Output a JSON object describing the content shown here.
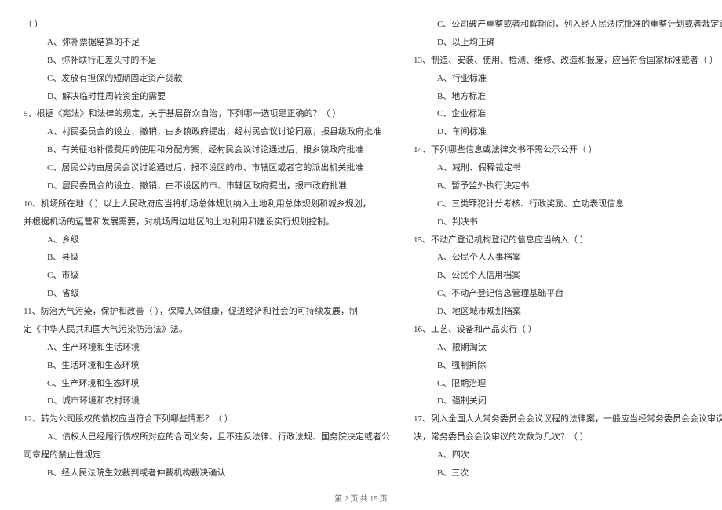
{
  "left": {
    "frag_top": "（    ）",
    "q8_A": "A、弥补票据结算的不足",
    "q8_B": "B、弥补联行汇差头寸的不足",
    "q8_C": "C、发放有担保的短期固定资产贷款",
    "q8_D": "D、解决临时性周转资金的需要",
    "q9_stem": "9、根据《宪法》和法律的规定，关于基层群众自治，下列哪一选项是正确的？（    ）",
    "q9_A": "A、村民委员会的设立、撤销，由乡镇政府提出，经村民会议讨论同意，报县级政府批准",
    "q9_B": "B、有关征地补偿费用的使用和分配方案，经村民会议讨论通过后，报乡镇政府批准",
    "q9_C": "C、居民公约由居民会议讨论通过后，报不设区的市、市辖区或者它的派出机关批准",
    "q9_D": "D、居民委员会的设立、撤销，由不设区的市、市辖区政府提出，报市政府批准",
    "q10_stem_l1": "10、机场所在地（    ）以上人民政府应当将机场总体规划纳入土地利用总体规划和城乡规划，",
    "q10_stem_l2": "并根据机场的运营和发展需要，对机场周边地区的土地利用和建设实行规划控制。",
    "q10_A": "A、乡级",
    "q10_B": "B、县级",
    "q10_C": "C、市级",
    "q10_D": "D、省级",
    "q11_stem_l1": "11、防治大气污染，保护和改善（    ），保障人体健康，促进经济和社会的可持续发展，制",
    "q11_stem_l2": "定《中华人民共和国大气污染防治法》法。",
    "q11_A": "A、生产环境和生活环境",
    "q11_B": "B、生活环境和生态环境",
    "q11_C": "C、生产环境和生态环境",
    "q11_D": "D、城市环境和农村环境",
    "q12_stem": "12、转为公司股权的债权应当符合下列哪些情形？（    ）",
    "q12_A_l1": "A、债权人已经履行债权所对应的合同义务，且不违反法律、行政法规、国务院决定或者公",
    "q12_A_l2": "司章程的禁止性规定",
    "q12_B": "B、经人民法院生效裁判或者仲裁机构裁决确认"
  },
  "right": {
    "q12_C": "C、公司破产重整或者和解期间，列入经人民法院批准的重整计划或者裁定认可的和解协议。",
    "q12_D": "D、以上均正确",
    "q13_stem": "13、制造、安装、使用、检测、维修、改造和报废，应当符合国家标准或者（    ）",
    "q13_A": "A、行业标准",
    "q13_B": "B、地方标准",
    "q13_C": "C、企业标准",
    "q13_D": "D、车间标准",
    "q14_stem": "14、下列哪些信息或法律文书不需公示公开（    ）",
    "q14_A": "A、减刑、假释裁定书",
    "q14_B": "B、暂予监外执行决定书",
    "q14_C": "C、三类罪犯计分考核、行政奖励、立功表现信息",
    "q14_D": "D、判决书",
    "q15_stem": "15、不动产登记机构登记的信息应当纳入（    ）",
    "q15_A": "A、公民个人人事档案",
    "q15_B": "B、公民个人信用档案",
    "q15_C": "C、不动产登记信息管理基础平台",
    "q15_D": "D、地区城市规划档案",
    "q16_stem": "16、工艺、设备和产品实行（    ）",
    "q16_A": "A、限期淘汰",
    "q16_B": "B、强制拆除",
    "q16_C": "C、限期治理",
    "q16_D": "D、强制关闭",
    "q17_stem_l1": "17、列入全国人大常务委员会会议议程的法律案，一般应当经常务委员会会议审议后再交付表",
    "q17_stem_l2": "决，常务委员会会议审议的次数为几次？（    ）",
    "q17_A": "A、四次",
    "q17_B": "B、三次"
  },
  "footer": "第 2 页 共 15 页"
}
